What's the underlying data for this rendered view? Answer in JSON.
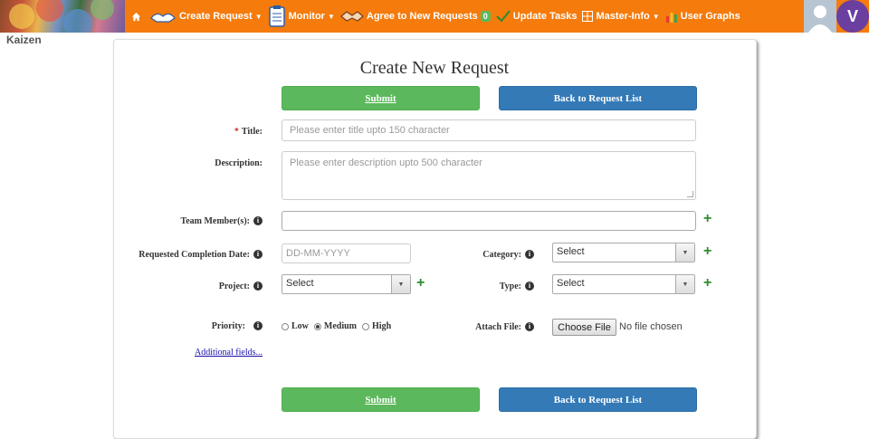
{
  "nav": {
    "items": [
      {
        "label": "Create Request"
      },
      {
        "label": "Monitor"
      },
      {
        "label": "Agree to New Requests",
        "badge": "0"
      },
      {
        "label": "Update Tasks"
      },
      {
        "label": "Master-Info"
      },
      {
        "label": "User Graphs"
      }
    ],
    "avatar_initial": "V",
    "accent": "#f47b0c"
  },
  "brand": "Kaizen",
  "form": {
    "title": "Create New Request",
    "submit_label": "Submit",
    "back_label": "Back to Request List",
    "title_field": {
      "label": "Title:",
      "placeholder": "Please enter title upto 150 character"
    },
    "description_field": {
      "label": "Description:",
      "placeholder": "Please enter description upto 500 character"
    },
    "team_members_label": "Team Member(s):",
    "completion_date": {
      "label": "Requested Completion Date:",
      "placeholder": "DD-MM-YYYY"
    },
    "category": {
      "label": "Category:",
      "value": "Select"
    },
    "project": {
      "label": "Project:",
      "value": "Select"
    },
    "type": {
      "label": "Type:",
      "value": "Select"
    },
    "priority": {
      "label": "Priority:",
      "options": [
        "Low",
        "Medium",
        "High"
      ],
      "selected": "Medium"
    },
    "attach": {
      "label": "Attach File:",
      "button": "Choose File",
      "status": "No file chosen"
    },
    "additional_link": "Additional fields..."
  }
}
